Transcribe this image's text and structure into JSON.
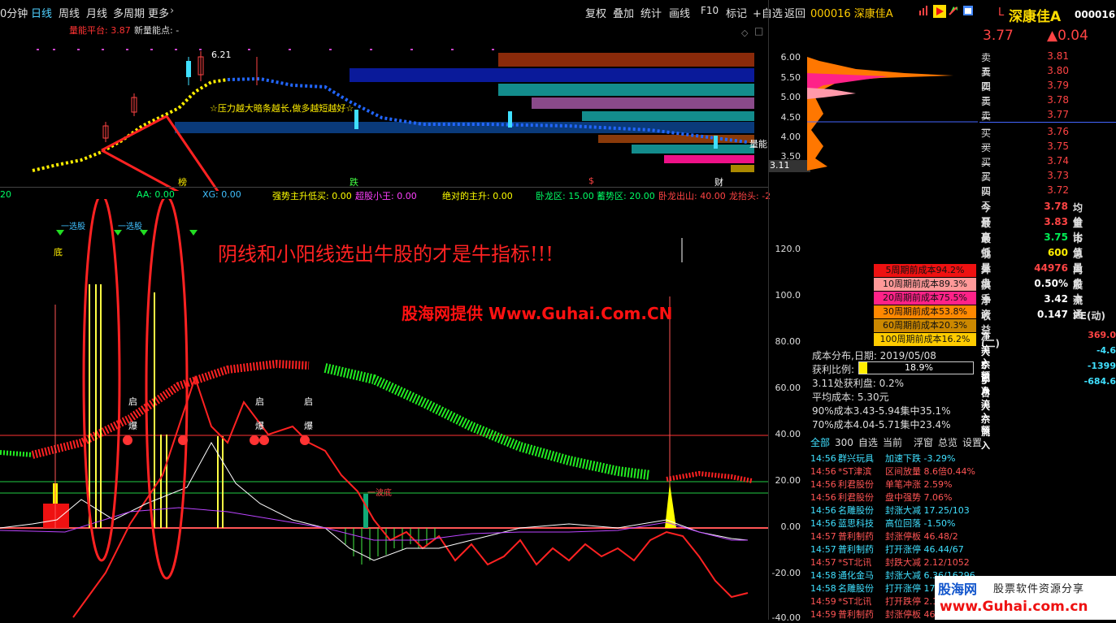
{
  "toolbar": {
    "period_partial": "0分钟",
    "daily": "日线",
    "weekly": "周线",
    "monthly": "月线",
    "multi": "多周期",
    "more": "更多",
    "restore": "复权",
    "overlay": "叠加",
    "stats": "统计",
    "draw": "画线",
    "f10": "F10",
    "mark": "标记",
    "watchlist": "+自选",
    "back": "返回",
    "stock_code": "000016",
    "stock_name": "深康佳A"
  },
  "main_chart": {
    "platform_label": "量能平台: 3.87",
    "new_point_label": "新量能点: -",
    "high_label": "6.21",
    "low_label": "3.11",
    "pressure_note": "☆压力越大暗条越长,做多越短越好☆",
    "liangneng": "量能",
    "price_axis": [
      "6.00",
      "5.50",
      "5.00",
      "4.50",
      "4.00",
      "3.50"
    ],
    "markers": [
      "榜",
      "跌",
      "$",
      "财"
    ]
  },
  "indicator_bar": [
    {
      "text": "20",
      "color": "#00ff66"
    },
    {
      "text": "AA: 0.00",
      "color": "#00ff66"
    },
    {
      "text": "XG: 0.00",
      "color": "#40c0ff"
    },
    {
      "text": "强势主升低买: 0.00",
      "color": "#ffff00"
    },
    {
      "text": "超股小王: 0.00",
      "color": "#ff40ff"
    },
    {
      "text": "绝对的主升: 0.00",
      "color": "#ffff00"
    },
    {
      "text": "卧龙区: 15.00",
      "color": "#00ff66"
    },
    {
      "text": "蓄势区: 20.00",
      "color": "#00ff66"
    },
    {
      "text": "卧龙出山: 40.00",
      "color": "#ff4444"
    },
    {
      "text": "龙抬头: -2",
      "color": "#ff4444"
    }
  ],
  "lower_chart": {
    "axis": [
      "120.0",
      "100.0",
      "80.00",
      "60.00",
      "40.00",
      "20.00",
      "0.00",
      "-20.00",
      "-40.00"
    ],
    "slogan": "阴线和小阳线选出牛股的才是牛指标!!!",
    "watermark": "股海网提供 Www.Guhai.Com.CN",
    "one_wave": "一波底",
    "bottom": "底",
    "qi": "启",
    "bao": "爆",
    "yibo": "一选股"
  },
  "right_panel": {
    "code": "000016",
    "name": "深康佳A",
    "price": "3.77",
    "change": "▲0.04",
    "asks": [
      {
        "label": "卖五",
        "price": "3.81"
      },
      {
        "label": "卖四",
        "price": "3.80"
      },
      {
        "label": "卖三",
        "price": "3.79"
      },
      {
        "label": "卖二",
        "price": "3.78"
      },
      {
        "label": "卖一",
        "price": "3.77"
      }
    ],
    "bids": [
      {
        "label": "买一",
        "price": "3.76"
      },
      {
        "label": "买二",
        "price": "3.75"
      },
      {
        "label": "买三",
        "price": "3.74"
      },
      {
        "label": "买四",
        "price": "3.73"
      },
      {
        "label": "买五",
        "price": "3.72"
      }
    ],
    "stats": [
      {
        "l1": "今开",
        "v1": "3.78",
        "l2": "均价"
      },
      {
        "l1": "最高",
        "v1": "3.83",
        "l2": "量比"
      },
      {
        "l1": "最低",
        "v1": "3.75",
        "l2": "市值"
      },
      {
        "l1": "现量",
        "v1": "600",
        "l2": "总量"
      },
      {
        "l1": "外盘",
        "v1": "44976",
        "l2": "内盘"
      },
      {
        "l1": "换手",
        "v1": "0.50%",
        "l2": "股本"
      },
      {
        "l1": "净资",
        "v1": "3.42",
        "l2": "流通"
      },
      {
        "l1": "收益(二)",
        "v1": "0.147",
        "l2": "PE(动)"
      }
    ],
    "flows": [
      {
        "label": "净流入额",
        "value": "369.0",
        "color": "#ff4444"
      },
      {
        "label": "大宗流入",
        "value": "-4.6",
        "color": "#40e0ff"
      },
      {
        "label": "5日净流入额",
        "value": "-1399",
        "color": "#40e0ff"
      },
      {
        "label": "5日大宗流入",
        "value": "-684.6",
        "color": "#40e0ff"
      }
    ]
  },
  "cost": [
    {
      "text": "5周期前成本94.2%",
      "bg": "#ee1111"
    },
    {
      "text": "10周期前成本89.3%",
      "bg": "#ff9999"
    },
    {
      "text": "20周期前成本75.5%",
      "bg": "#ff2288"
    },
    {
      "text": "30周期前成本53.8%",
      "bg": "#ff8800"
    },
    {
      "text": "60周期前成本20.3%",
      "bg": "#cc8800"
    },
    {
      "text": "100周期前成本16.2%",
      "bg": "#ffcc00"
    }
  ],
  "chip_info": {
    "date_line": "成本分布,日期:    2019/05/08",
    "profit_label": "获利比例:",
    "profit_value": "18.9%",
    "profit_at": "3.11处获利盘:  0.2%",
    "avg_cost": "平均成本:   5.30元",
    "c90": "90%成本3.43-5.94集中35.1%",
    "c70": "70%成本4.04-5.71集中23.4%"
  },
  "tabs": [
    "全部",
    "300",
    "自选",
    "当前",
    "浮窗",
    "总览",
    "设置"
  ],
  "news": [
    {
      "time": "14:56",
      "name": "群兴玩具",
      "event": "加速下跌 -3.29%",
      "color": "#40e0ff"
    },
    {
      "time": "14:56",
      "name": "*ST津滨",
      "event": "区间放量 8.6倍0.44%",
      "color": "#ff5555"
    },
    {
      "time": "14:56",
      "name": "利君股份",
      "event": "单笔冲涨 2.59%",
      "color": "#ff5555"
    },
    {
      "time": "14:56",
      "name": "利君股份",
      "event": "盘中强势 7.06%",
      "color": "#ff5555"
    },
    {
      "time": "14:56",
      "name": "名雕股份",
      "event": "封涨大减 17.25/103",
      "color": "#40e0ff"
    },
    {
      "time": "14:56",
      "name": "蓝思科技",
      "event": "高位回落 -1.50%",
      "color": "#40e0ff"
    },
    {
      "time": "14:57",
      "name": "普利制药",
      "event": "封涨停板 46.48/2",
      "color": "#ff5555"
    },
    {
      "time": "14:57",
      "name": "普利制药",
      "event": "打开涨停 46.44/67",
      "color": "#40e0ff"
    },
    {
      "time": "14:57",
      "name": "*ST北讯",
      "event": "封跌大减 2.12/1052",
      "color": "#ff5555"
    },
    {
      "time": "14:58",
      "name": "通化金马",
      "event": "封涨大减 6.36/16296",
      "color": "#40e0ff"
    },
    {
      "time": "14:58",
      "name": "名雕股份",
      "event": "打开涨停 17",
      "color": "#40e0ff"
    },
    {
      "time": "14:59",
      "name": "*ST北讯",
      "event": "打开跌停 2.1",
      "color": "#ff5555"
    },
    {
      "time": "14:59",
      "name": "普利制药",
      "event": "封涨停板 46",
      "color": "#ff5555"
    }
  ],
  "logo": {
    "brand": "股海网",
    "tagline": "股票软件资源分享",
    "url": "www.Guhai.com.cn"
  }
}
